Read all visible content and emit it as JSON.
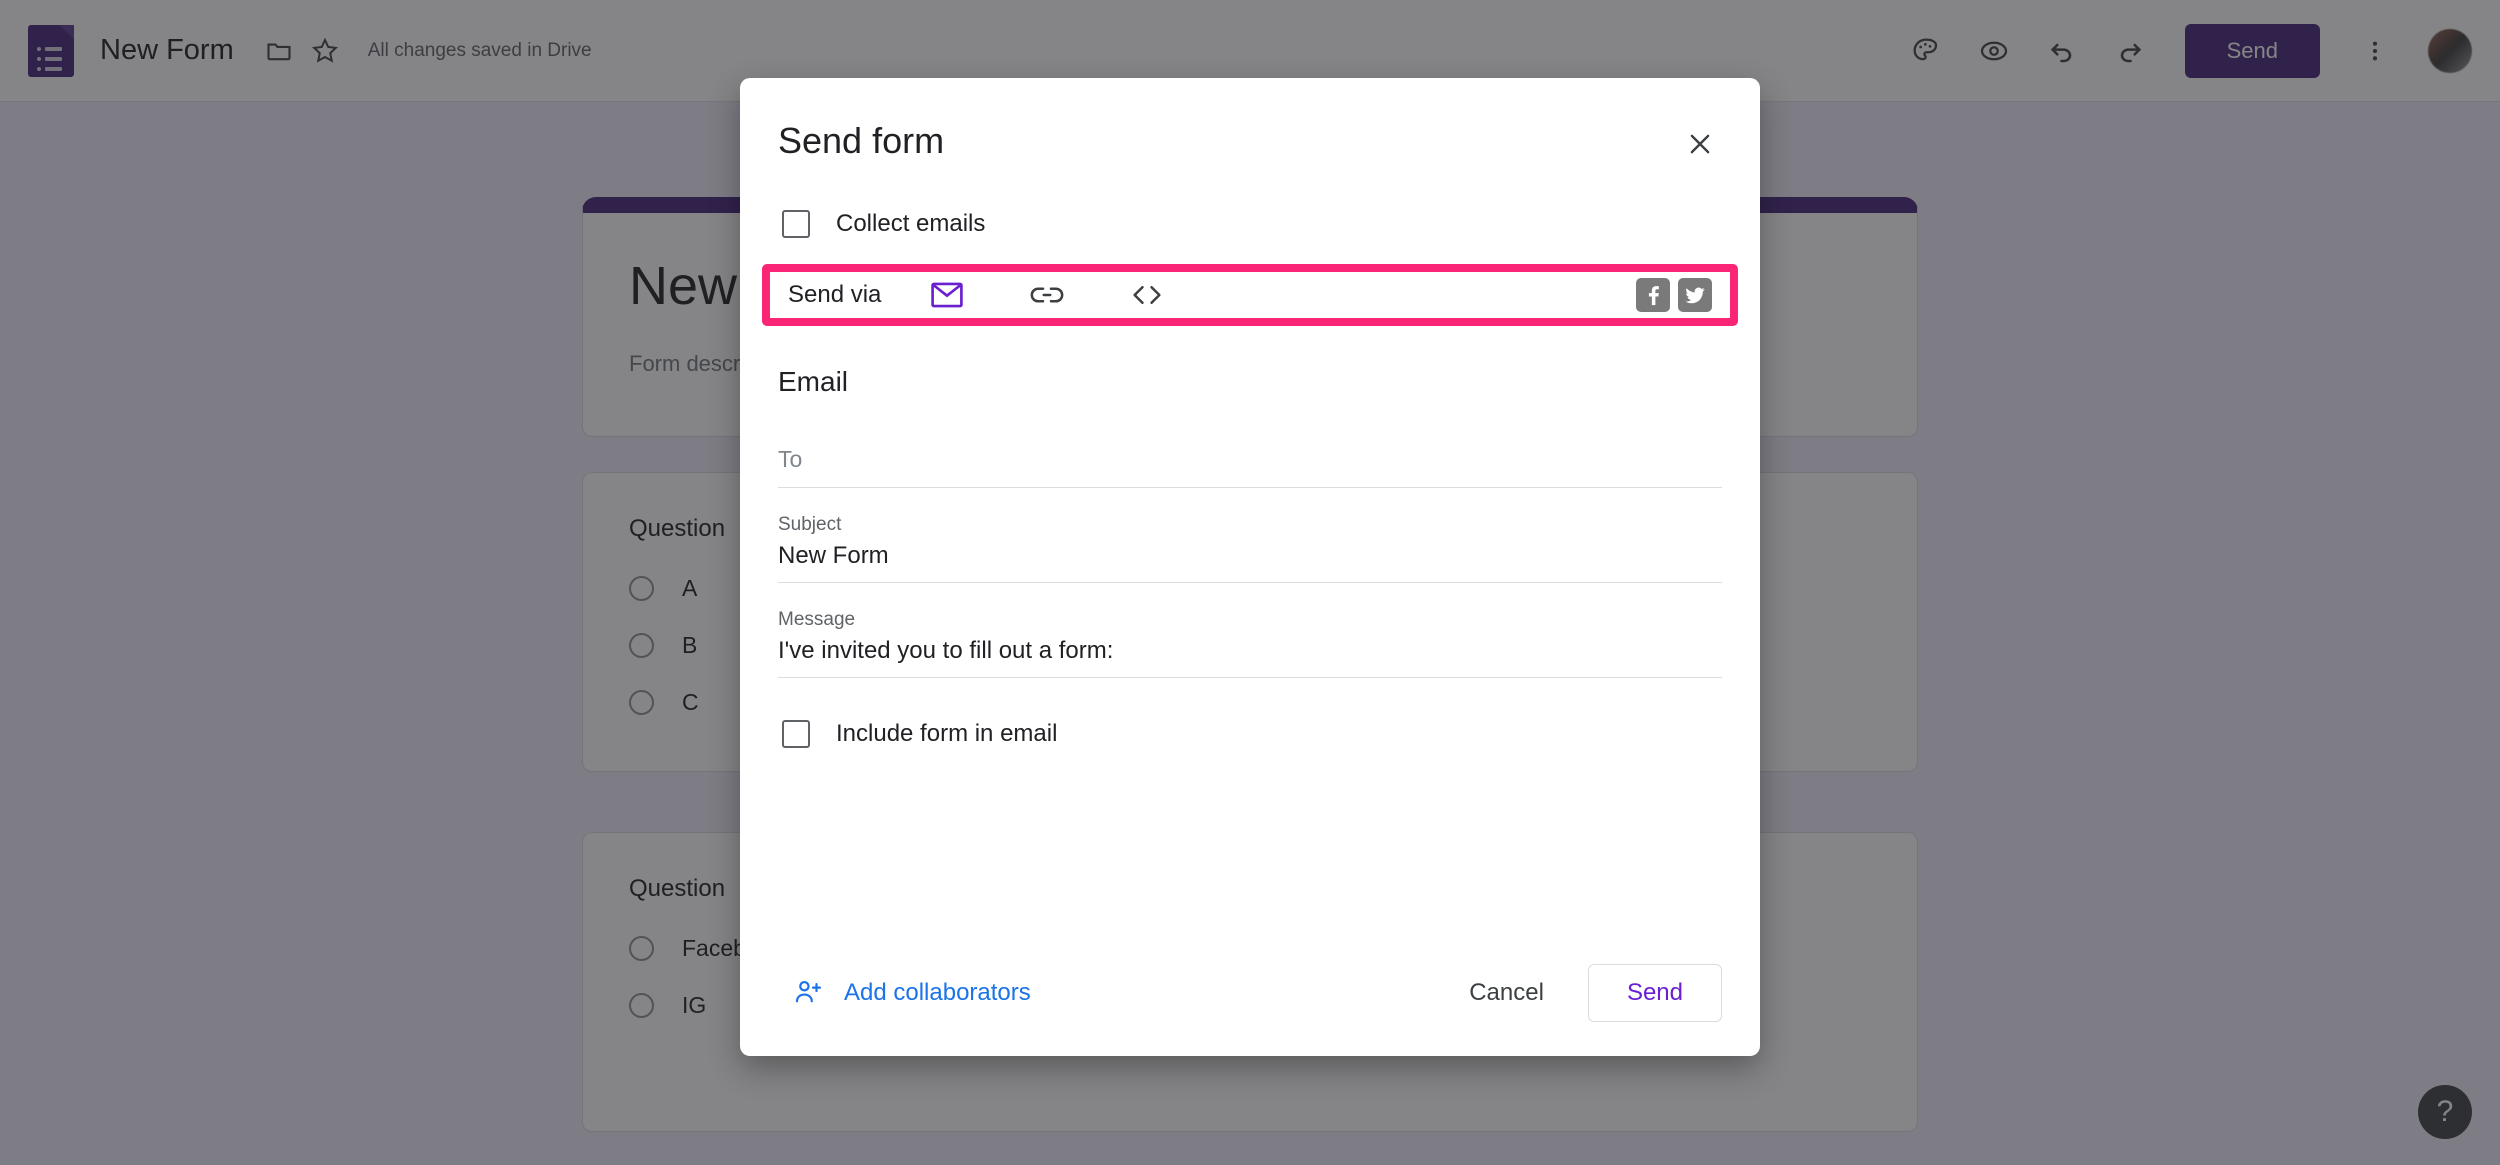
{
  "app": {
    "logo_icon": "google-forms-icon",
    "doc_title": "New Form",
    "folder_icon": "folder-icon",
    "star_icon": "star-icon",
    "save_status": "All changes saved in Drive",
    "toolbar": {
      "theme_icon": "palette-icon",
      "preview_icon": "eye-preview-icon",
      "undo_icon": "undo-icon",
      "redo_icon": "redo-icon",
      "send_label": "Send",
      "more_icon": "more-vert-icon",
      "avatar": "user-avatar"
    },
    "help_label": "?",
    "accent_purple": "#46257a"
  },
  "form_canvas": {
    "header_card": {
      "title": "New Form",
      "description": "Form description"
    },
    "questions": [
      {
        "title": "Question",
        "options": [
          "A",
          "B",
          "C"
        ]
      },
      {
        "title": "Question",
        "options": [
          "Facebook",
          "IG"
        ]
      }
    ]
  },
  "dialog": {
    "title": "Send form",
    "close_icon": "close-icon",
    "collect_emails": {
      "label": "Collect emails",
      "checked": false
    },
    "send_via": {
      "label": "Send via",
      "highlight_color": "#fb2576",
      "tabs": [
        {
          "name": "email",
          "icon": "envelope-icon",
          "selected": true,
          "color": "#6a1fd0"
        },
        {
          "name": "link",
          "icon": "link-chain-icon",
          "selected": false,
          "color": "#3c4043"
        },
        {
          "name": "embed",
          "icon": "embed-code-icon",
          "selected": false,
          "color": "#3c4043"
        }
      ],
      "social": [
        {
          "name": "facebook",
          "icon": "facebook-icon",
          "glyph": "f"
        },
        {
          "name": "twitter",
          "icon": "twitter-icon",
          "glyph": "twitter-bird"
        }
      ]
    },
    "email_section": {
      "heading": "Email",
      "to": {
        "label": "To",
        "placeholder": "To",
        "value": ""
      },
      "subject": {
        "label": "Subject",
        "value": "New Form"
      },
      "message": {
        "label": "Message",
        "value": "I've invited you to fill out a form:"
      }
    },
    "include_form": {
      "label": "Include form in email",
      "checked": false
    },
    "footer": {
      "add_collaborators_label": "Add collaborators",
      "add_collaborators_icon": "person-add-icon",
      "add_collaborators_color": "#1a73e8",
      "cancel_label": "Cancel",
      "send_label": "Send",
      "send_color": "#6a1fd0"
    }
  }
}
